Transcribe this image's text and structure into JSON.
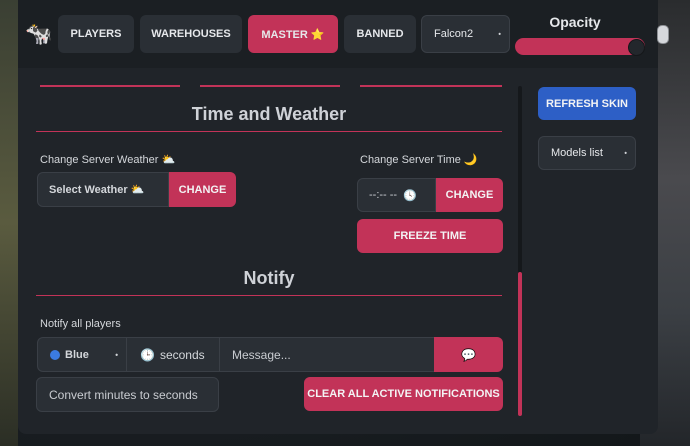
{
  "tabs": [
    "PLAYERS",
    "WAREHOUSES",
    "MASTER ⭐",
    "BANNED"
  ],
  "player_select": "Falcon2",
  "opacity_label": "Opacity",
  "opacity_value": 0.92,
  "time_weather_title": "Time and Weather",
  "weather": {
    "label": "Change Server Weather ⛅",
    "select_value": "Select Weather ⛅",
    "button": "CHANGE"
  },
  "time": {
    "label": "Change Server Time 🌙",
    "input_value": "--:-- --",
    "button": "CHANGE",
    "freeze_button": "FREEZE TIME"
  },
  "notify_title": "Notify",
  "notify": {
    "label": "Notify all players",
    "color_select": "Blue",
    "duration_label": "seconds",
    "message_placeholder": "Message...",
    "convert_label": "Convert minutes to seconds",
    "clear_button": "CLEAR ALL ACTIVE NOTIFICATIONS"
  },
  "sidebar": {
    "refresh_button": "REFRESH SKIN",
    "models_select": "Models list"
  },
  "colors": {
    "accent": "#c23358",
    "blue": "#2d5fc6",
    "panel": "#202429"
  },
  "icons": [
    "cow-logo-icon",
    "chevron-down-icon",
    "clock-icon",
    "chat-bubble-icon",
    "blue-dot-icon",
    "timer-icon",
    "mouse-icon"
  ]
}
